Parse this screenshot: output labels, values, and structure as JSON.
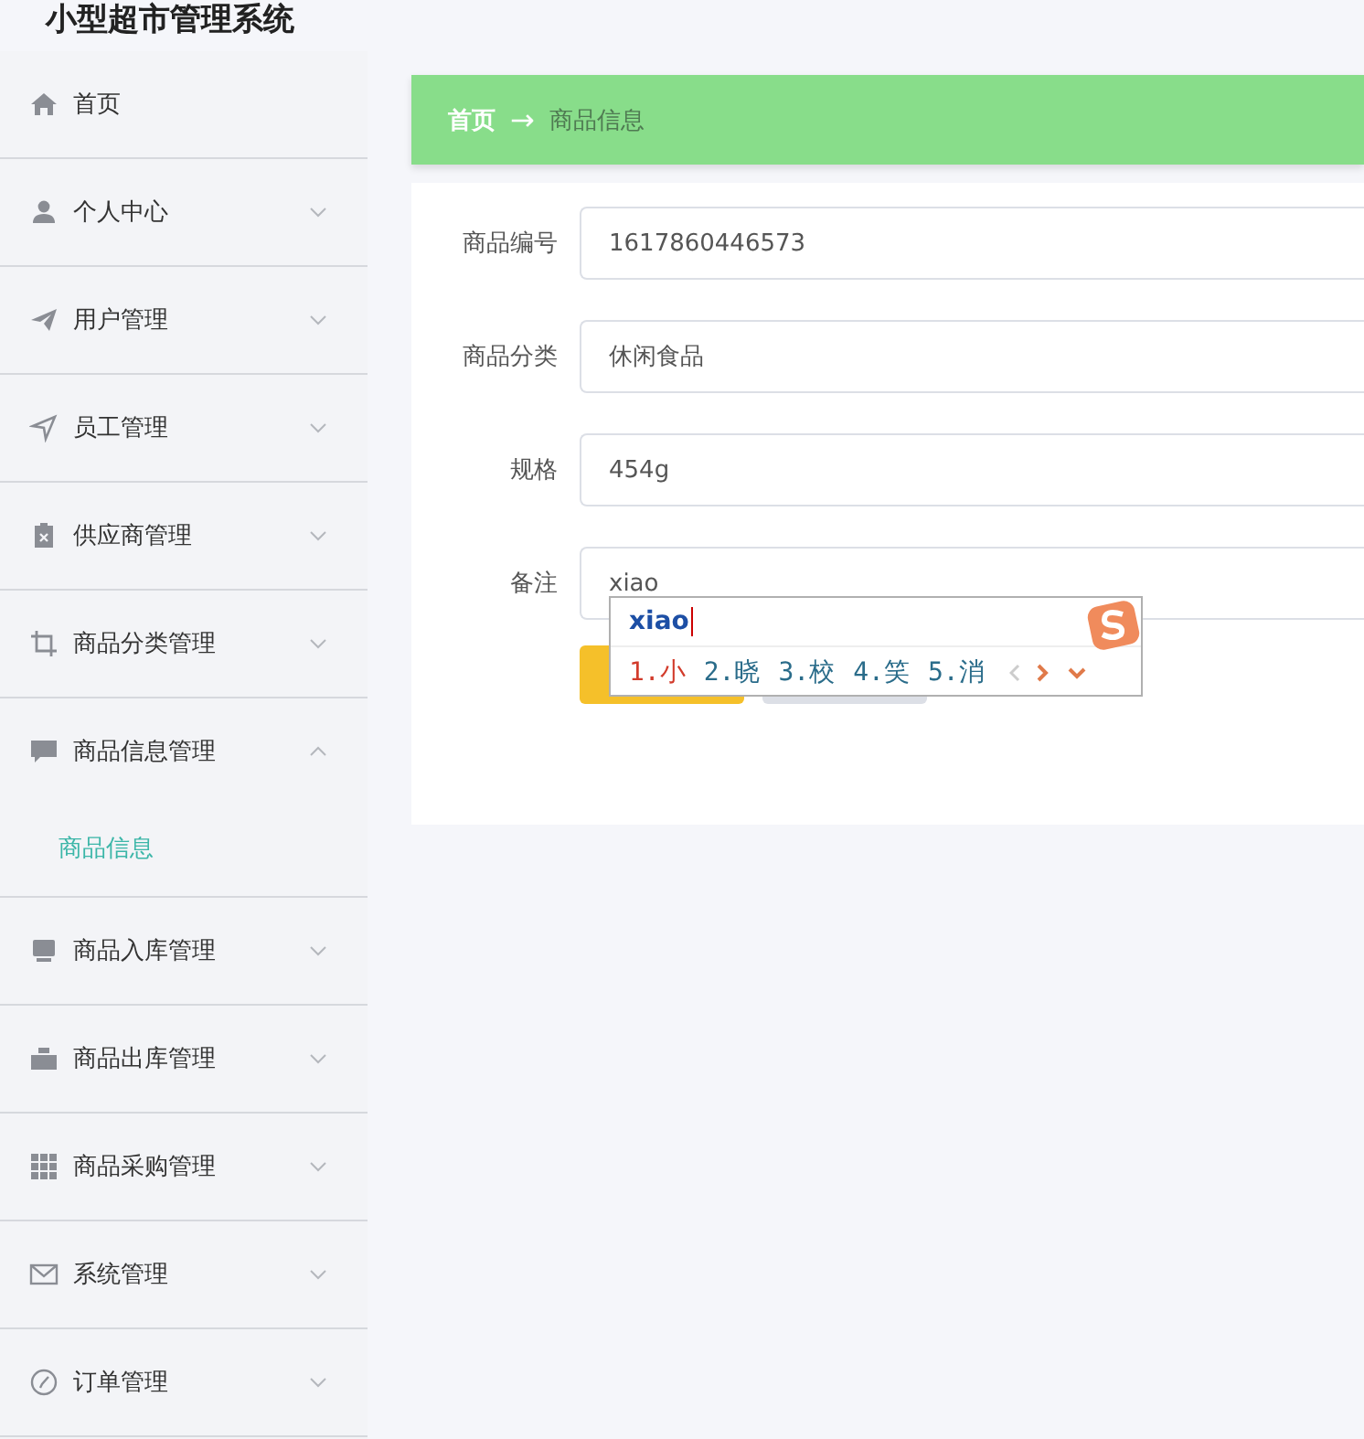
{
  "app_title": "小型超市管理系统",
  "sidebar": {
    "items": [
      {
        "label": "首页",
        "kind": "link"
      },
      {
        "label": "个人中心",
        "kind": "menu",
        "expanded": false
      },
      {
        "label": "用户管理",
        "kind": "menu",
        "expanded": false
      },
      {
        "label": "员工管理",
        "kind": "menu",
        "expanded": false
      },
      {
        "label": "供应商管理",
        "kind": "menu",
        "expanded": false
      },
      {
        "label": "商品分类管理",
        "kind": "menu",
        "expanded": false
      },
      {
        "label": "商品信息管理",
        "kind": "menu",
        "expanded": true,
        "children": [
          {
            "label": "商品信息",
            "selected": true
          }
        ]
      },
      {
        "label": "商品入库管理",
        "kind": "menu",
        "expanded": false
      },
      {
        "label": "商品出库管理",
        "kind": "menu",
        "expanded": false
      },
      {
        "label": "商品采购管理",
        "kind": "menu",
        "expanded": false
      },
      {
        "label": "系统管理",
        "kind": "menu",
        "expanded": false
      },
      {
        "label": "订单管理",
        "kind": "menu",
        "expanded": false
      }
    ]
  },
  "breadcrumb": {
    "separator": "→",
    "items": [
      {
        "label": "首页",
        "current": false
      },
      {
        "label": "商品信息",
        "current": true
      }
    ]
  },
  "form": {
    "fields": [
      {
        "label": "商品编号",
        "value": "1617860446573"
      },
      {
        "label": "商品分类",
        "value": "休闲食品"
      },
      {
        "label": "规格",
        "value": "454g"
      },
      {
        "label": "备注",
        "value": "xiao"
      }
    ],
    "buttons": [
      {
        "kind": "primary"
      },
      {
        "kind": "secondary"
      }
    ]
  },
  "ime": {
    "composition": "xiao",
    "candidates": [
      {
        "label": "1.小",
        "selected": true
      },
      {
        "label": "2.晓",
        "selected": false
      },
      {
        "label": "3.校",
        "selected": false
      },
      {
        "label": "4.笑",
        "selected": false
      },
      {
        "label": "5.消",
        "selected": false
      }
    ]
  }
}
